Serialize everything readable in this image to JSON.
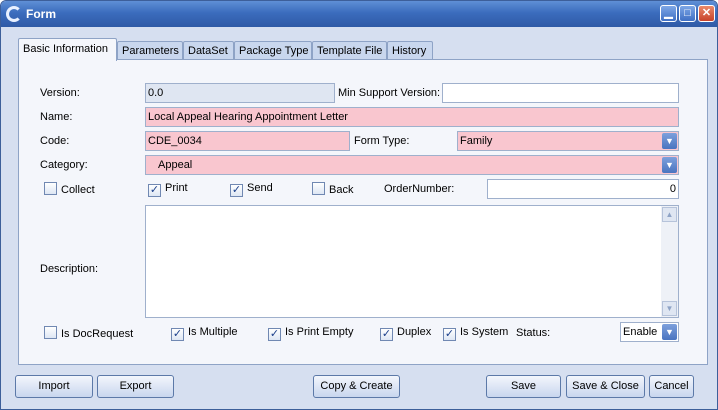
{
  "window": {
    "title": "Form",
    "controls": {
      "minimize": "▁",
      "maximize": "□",
      "close": "✕"
    }
  },
  "tabs": [
    "Basic Information",
    "Parameters",
    "DataSet",
    "Package Type",
    "Template File",
    "History"
  ],
  "form": {
    "version_label": "Version:",
    "version_value": "0.0",
    "min_support_label": "Min Support Version:",
    "min_support_value": "",
    "name_label": "Name:",
    "name_value": "Local Appeal Hearing Appointment Letter",
    "code_label": "Code:",
    "code_value": "CDE_0034",
    "form_type_label": "Form Type:",
    "form_type_value": "Family",
    "category_label": "Category:",
    "category_value": "Appeal",
    "collect_label": "Collect",
    "collect_checked": false,
    "print_label": "Print",
    "print_checked": true,
    "send_label": "Send",
    "send_checked": true,
    "back_label": "Back",
    "back_checked": false,
    "order_number_label": "OrderNumber:",
    "order_number_value": "0",
    "description_label": "Description:",
    "description_value": "",
    "is_docrequest_label": "Is DocRequest",
    "is_docrequest_checked": false,
    "is_multiple_label": "Is Multiple",
    "is_multiple_checked": true,
    "is_print_empty_label": "Is Print Empty",
    "is_print_empty_checked": true,
    "duplex_label": "Duplex",
    "duplex_checked": true,
    "is_system_label": "Is System",
    "is_system_checked": true,
    "status_label": "Status:",
    "status_value": "Enable"
  },
  "buttons": {
    "import": "Import",
    "export": "Export",
    "copy_create": "Copy & Create",
    "save": "Save",
    "save_close": "Save & Close",
    "cancel": "Cancel"
  },
  "colors": {
    "titlebar": "#3b6cbd",
    "required_field": "#f9c6cf",
    "panel": "#f4f6fb"
  }
}
